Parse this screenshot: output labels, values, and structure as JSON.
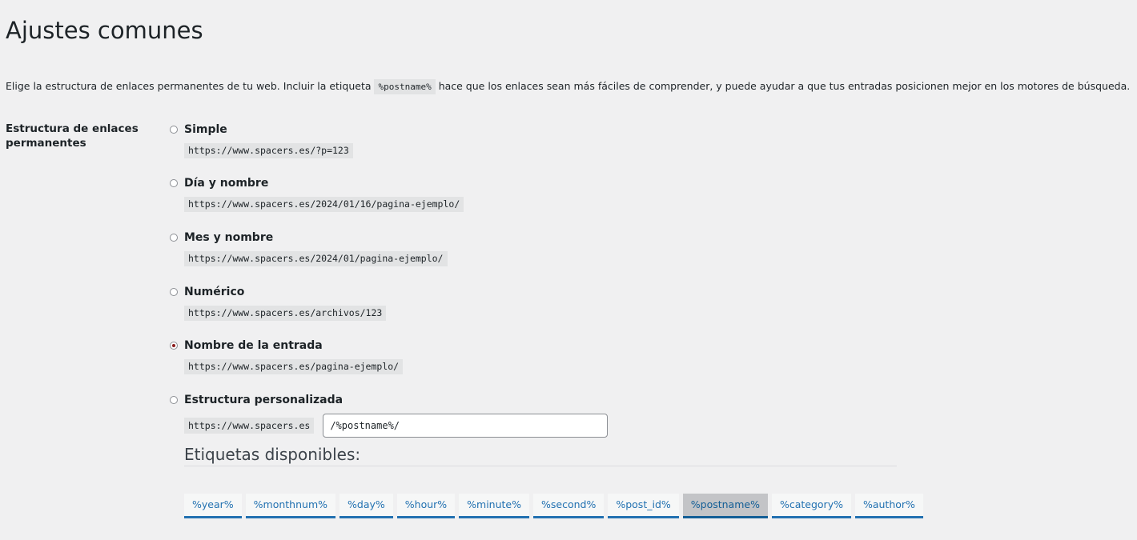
{
  "page": {
    "title": "Ajustes comunes",
    "intro_before": "Elige la estructura de enlaces permanentes de tu web. Incluir la etiqueta ",
    "intro_code": "%postname%",
    "intro_after": " hace que los enlaces sean más fáciles de comprender, y puede ayudar a que tus entradas posicionen mejor en los motores de búsqueda."
  },
  "permalink": {
    "label": "Estructura de enlaces permanentes",
    "selected": "Nombre de la entrada",
    "options": [
      {
        "label": "Simple",
        "example": "https://www.spacers.es/?p=123",
        "checked": false
      },
      {
        "label": "Día y nombre",
        "example": "https://www.spacers.es/2024/01/16/pagina-ejemplo/",
        "checked": false
      },
      {
        "label": "Mes y nombre",
        "example": "https://www.spacers.es/2024/01/pagina-ejemplo/",
        "checked": false
      },
      {
        "label": "Numérico",
        "example": "https://www.spacers.es/archivos/123",
        "checked": false
      },
      {
        "label": "Nombre de la entrada",
        "example": "https://www.spacers.es/pagina-ejemplo/",
        "checked": true
      },
      {
        "label": "Estructura personalizada",
        "checked": false
      }
    ],
    "custom": {
      "base": "https://www.spacers.es",
      "value": "/%postname%/"
    }
  },
  "tags": {
    "heading": "Etiquetas disponibles:",
    "items": [
      {
        "label": "%year%",
        "active": false
      },
      {
        "label": "%monthnum%",
        "active": false
      },
      {
        "label": "%day%",
        "active": false
      },
      {
        "label": "%hour%",
        "active": false
      },
      {
        "label": "%minute%",
        "active": false
      },
      {
        "label": "%second%",
        "active": false
      },
      {
        "label": "%post_id%",
        "active": false
      },
      {
        "label": "%postname%",
        "active": true
      },
      {
        "label": "%category%",
        "active": false
      },
      {
        "label": "%author%",
        "active": false
      }
    ]
  },
  "colors": {
    "background": "#f0f0f1",
    "link": "#2271b1",
    "radio_checked": "#8b1a1a"
  }
}
